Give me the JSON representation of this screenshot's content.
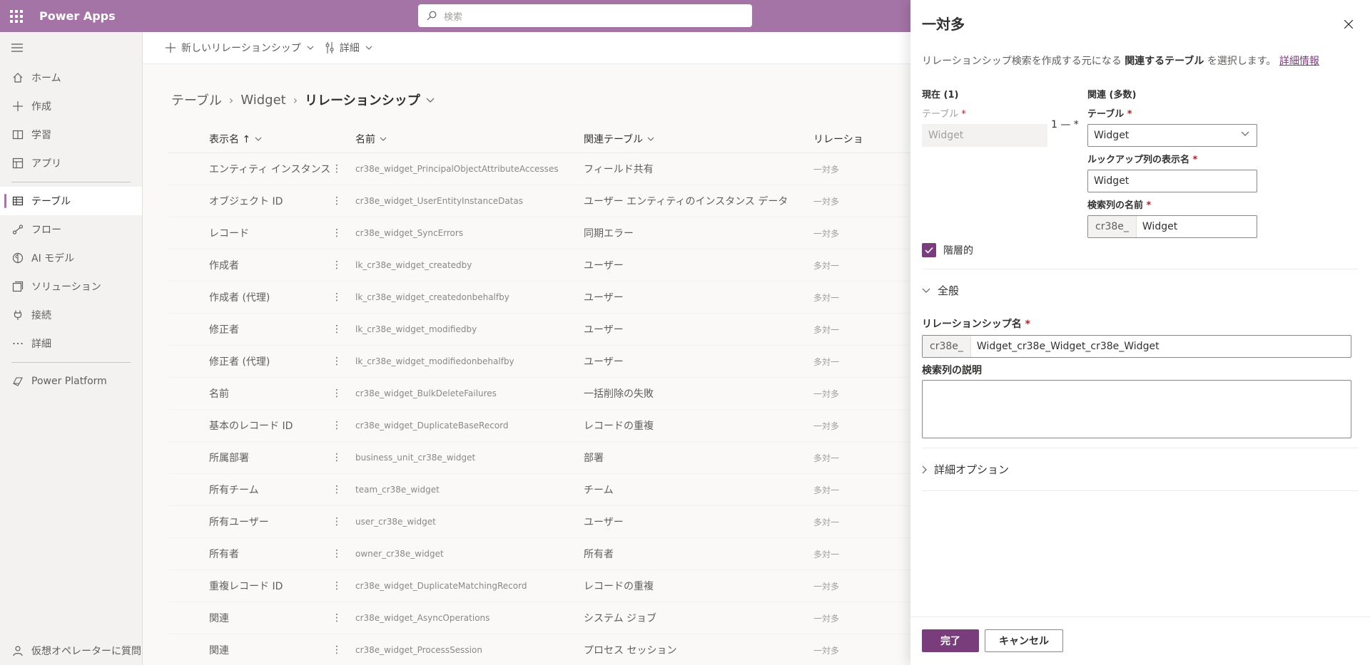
{
  "topbar": {
    "app_name": "Power Apps",
    "search_placeholder": "検索"
  },
  "leftnav": {
    "items": [
      {
        "label": "ホーム",
        "icon": "home-icon"
      },
      {
        "label": "作成",
        "icon": "plus-icon"
      },
      {
        "label": "学習",
        "icon": "book-icon"
      },
      {
        "label": "アプリ",
        "icon": "apps-icon"
      },
      {
        "label": "テーブル",
        "icon": "table-icon",
        "active": true
      },
      {
        "label": "フロー",
        "icon": "flow-icon"
      },
      {
        "label": "AI モデル",
        "icon": "ai-model-icon"
      },
      {
        "label": "ソリューション",
        "icon": "solution-icon"
      },
      {
        "label": "接続",
        "icon": "plug-icon"
      },
      {
        "label": "詳細",
        "icon": "more-icon"
      },
      {
        "label": "Power Platform",
        "icon": "power-platform-icon"
      }
    ],
    "bottom_label": "仮想オペレーターに質問"
  },
  "commandbar": {
    "new_relationship": "新しいリレーションシップ",
    "details": "詳細"
  },
  "breadcrumb": {
    "items": [
      "テーブル",
      "Widget",
      "リレーションシップ"
    ]
  },
  "grid": {
    "headers": {
      "display_name": "表示名 ↑",
      "name": "名前",
      "related_table": "関連テーブル",
      "relationship_type": "リレーショ"
    },
    "rows": [
      {
        "display": "エンティティ インスタンス",
        "name": "cr38e_widget_PrincipalObjectAttributeAccesses",
        "related": "フィールド共有",
        "type": "一対多"
      },
      {
        "display": "オブジェクト ID",
        "name": "cr38e_widget_UserEntityInstanceDatas",
        "related": "ユーザー エンティティのインスタンス データ",
        "type": "一対多"
      },
      {
        "display": "レコード",
        "name": "cr38e_widget_SyncErrors",
        "related": "同期エラー",
        "type": "一対多"
      },
      {
        "display": "作成者",
        "name": "lk_cr38e_widget_createdby",
        "related": "ユーザー",
        "type": "多対一"
      },
      {
        "display": "作成者 (代理)",
        "name": "lk_cr38e_widget_createdonbehalfby",
        "related": "ユーザー",
        "type": "多対一"
      },
      {
        "display": "修正者",
        "name": "lk_cr38e_widget_modifiedby",
        "related": "ユーザー",
        "type": "多対一"
      },
      {
        "display": "修正者 (代理)",
        "name": "lk_cr38e_widget_modifiedonbehalfby",
        "related": "ユーザー",
        "type": "多対一"
      },
      {
        "display": "名前",
        "name": "cr38e_widget_BulkDeleteFailures",
        "related": "一括削除の失敗",
        "type": "一対多"
      },
      {
        "display": "基本のレコード ID",
        "name": "cr38e_widget_DuplicateBaseRecord",
        "related": "レコードの重複",
        "type": "一対多"
      },
      {
        "display": "所属部署",
        "name": "business_unit_cr38e_widget",
        "related": "部署",
        "type": "多対一"
      },
      {
        "display": "所有チーム",
        "name": "team_cr38e_widget",
        "related": "チーム",
        "type": "多対一"
      },
      {
        "display": "所有ユーザー",
        "name": "user_cr38e_widget",
        "related": "ユーザー",
        "type": "多対一"
      },
      {
        "display": "所有者",
        "name": "owner_cr38e_widget",
        "related": "所有者",
        "type": "多対一"
      },
      {
        "display": "重複レコード ID",
        "name": "cr38e_widget_DuplicateMatchingRecord",
        "related": "レコードの重複",
        "type": "一対多"
      },
      {
        "display": "関連",
        "name": "cr38e_widget_AsyncOperations",
        "related": "システム ジョブ",
        "type": "一対多"
      },
      {
        "display": "関連",
        "name": "cr38e_widget_ProcessSession",
        "related": "プロセス セッション",
        "type": "一対多"
      }
    ]
  },
  "panel": {
    "title": "一対多",
    "desc_prefix": "リレーションシップ検索を作成する元になる",
    "desc_bold": "関連するテーブル",
    "desc_suffix": "を選択します。",
    "desc_link": "詳細情報",
    "current_heading": "現在 (1)",
    "current_table_label": "テーブル",
    "current_table_value": "Widget",
    "one_to_many_symbol": "1 — *",
    "related_heading": "関連 (多数)",
    "related_table_label": "テーブル",
    "related_table_value": "Widget",
    "lookup_display_label": "ルックアップ列の表示名",
    "lookup_display_value": "Widget",
    "lookup_name_label": "検索列の名前",
    "lookup_name_prefix": "cr38e_",
    "lookup_name_value": "Widget",
    "hierarchical_label": "階層的",
    "general_section": "全般",
    "relationship_name_label": "リレーションシップ名",
    "relationship_name_prefix": "cr38e_",
    "relationship_name_value": "Widget_cr38e_Widget_cr38e_Widget",
    "lookup_desc_label": "検索列の説明",
    "advanced_section": "詳細オプション",
    "required_mark": "*",
    "done_button": "完了",
    "cancel_button": "キャンセル"
  },
  "colors": {
    "topbar": "#a374a5",
    "primary": "#7a3d7c"
  }
}
